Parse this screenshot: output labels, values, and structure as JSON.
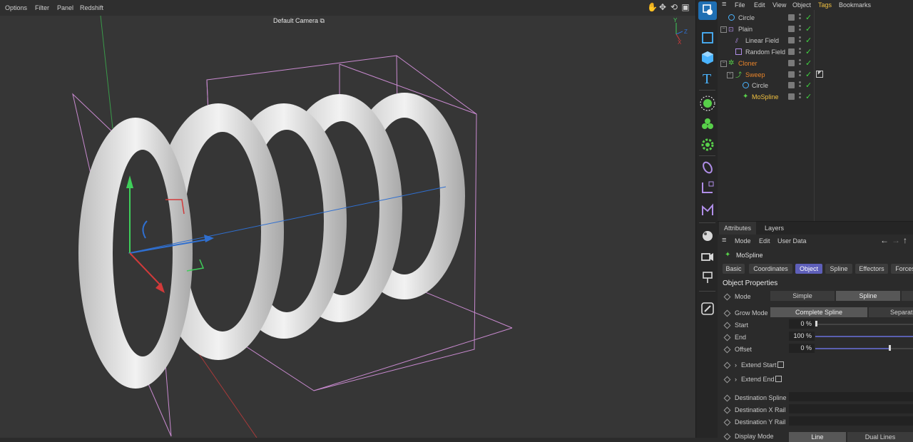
{
  "viewport": {
    "menu": [
      "Options",
      "Filter",
      "Panel",
      "Redshift"
    ],
    "camera_label": "Default Camera",
    "gizmo_axes": [
      "Y",
      "Z",
      "X"
    ]
  },
  "object_manager": {
    "menu": [
      "File",
      "Edit",
      "View",
      "Object",
      "Tags",
      "Bookmarks"
    ],
    "active_menu_color": "#f0c040",
    "objects": [
      {
        "name": "Circle",
        "color": "#c8c8c8",
        "icon": "circle-icon"
      },
      {
        "name": "Plain",
        "color": "#c8c8c8",
        "icon": "plain-effector-icon"
      },
      {
        "name": "Linear Field",
        "color": "#c8c8c8",
        "icon": "linear-field-icon"
      },
      {
        "name": "Random Field",
        "color": "#c8c8c8",
        "icon": "random-field-icon"
      },
      {
        "name": "Cloner",
        "color": "#e8842a",
        "icon": "cloner-icon"
      },
      {
        "name": "Sweep",
        "color": "#e8842a",
        "icon": "sweep-icon"
      },
      {
        "name": "Circle",
        "color": "#c8c8c8",
        "icon": "circle-icon"
      },
      {
        "name": "MoSpline",
        "color": "#f0c040",
        "icon": "mospline-icon"
      }
    ]
  },
  "attributes": {
    "tabs": [
      "Attributes",
      "Layers"
    ],
    "menu": [
      "Mode",
      "Edit",
      "User Data"
    ],
    "object_name": "MoSpline",
    "subtabs": [
      "Basic",
      "Coordinates",
      "Object",
      "Spline",
      "Effectors",
      "Forces"
    ],
    "active_subtab": "Object",
    "section": "Object Properties",
    "mode": {
      "label": "Mode",
      "options": [
        "Simple",
        "Spline"
      ],
      "selected": "Spline"
    },
    "grow_mode": {
      "label": "Grow Mode",
      "options": [
        "Complete Spline",
        "Separate"
      ],
      "selected": "Complete Spline"
    },
    "start": {
      "label": "Start",
      "value": "0 %",
      "fraction": 0.0
    },
    "end": {
      "label": "End",
      "value": "100 %",
      "fraction": 1.0
    },
    "offset": {
      "label": "Offset",
      "value": "0 %",
      "fraction": 0.77
    },
    "extend_start": "Extend Start",
    "extend_end": "Extend End",
    "destination_spline": "Destination Spline",
    "destination_x_rail": "Destination X Rail",
    "destination_y_rail": "Destination Y Rail",
    "display_mode": {
      "label": "Display Mode",
      "options": [
        "Line",
        "Dual Lines"
      ]
    }
  },
  "colors": {
    "accent": "#5e5fb9",
    "check_green": "#3fd23f",
    "toolbar_highlight": "#1f6fb3"
  }
}
